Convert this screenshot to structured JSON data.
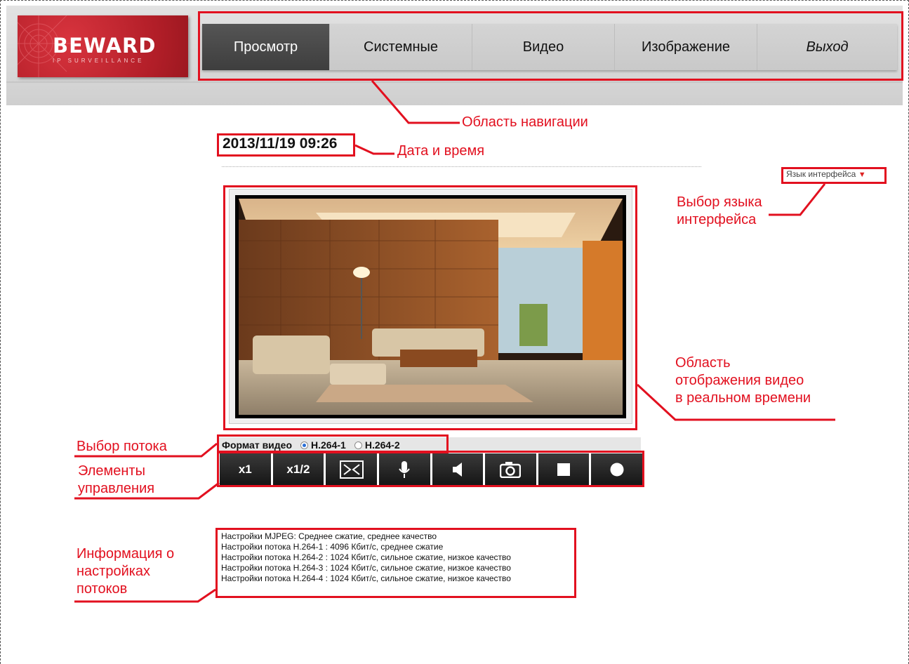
{
  "header": {
    "logo": {
      "brand": "BEWARD",
      "tagline": "IP SURVEILLANCE"
    },
    "nav": [
      {
        "label": "Просмотр",
        "active": true
      },
      {
        "label": "Системные"
      },
      {
        "label": "Видео"
      },
      {
        "label": "Изображение"
      },
      {
        "label": "Выход"
      }
    ]
  },
  "datetime": "2013/11/19 09:26",
  "language_selector": {
    "label": "Язык интерфейса",
    "arrow": "▼"
  },
  "stream_select": {
    "label": "Формат видео",
    "options": [
      {
        "label": "H.264-1",
        "selected": true
      },
      {
        "label": "H.264-2",
        "selected": false
      }
    ]
  },
  "controls": [
    {
      "label": "x1",
      "icon": null
    },
    {
      "label": "x1/2",
      "icon": null
    },
    {
      "label": "",
      "icon": "fit-screen-icon"
    },
    {
      "label": "",
      "icon": "microphone-icon"
    },
    {
      "label": "",
      "icon": "speaker-icon"
    },
    {
      "label": "",
      "icon": "camera-snapshot-icon"
    },
    {
      "label": "",
      "icon": "stop-icon"
    },
    {
      "label": "",
      "icon": "record-icon"
    }
  ],
  "stream_info": [
    "Настройки MJPEG: Среднее сжатие, среднее качество",
    "Настройки потока H.264-1 : 4096 Кбит/с, среднее сжатие",
    "Настройки потока H.264-2 : 1024 Кбит/с, сильное сжатие, низкое качество",
    "Настройки потока H.264-3 : 1024 Кбит/с, сильное сжатие, низкое качество",
    "Настройки потока H.264-4 : 1024 Кбит/с, сильное сжатие, низкое качество"
  ],
  "annotations": {
    "nav_area": "Область навигации",
    "datetime": "Дата и время",
    "language_line1": "Выбор языка",
    "language_line2": "интерфейса",
    "video_line1": "Область",
    "video_line2": "отображения видео",
    "video_line3": "в реальном времени",
    "stream_select": "Выбор потока",
    "controls_line1": "Элементы",
    "controls_line2": "управления",
    "info_line1": "Информация о",
    "info_line2": "настройках",
    "info_line3": "потоков"
  },
  "colors": {
    "annotation_red": "#e2101f",
    "logo_red": "#b21e28",
    "nav_active": "#444444"
  }
}
